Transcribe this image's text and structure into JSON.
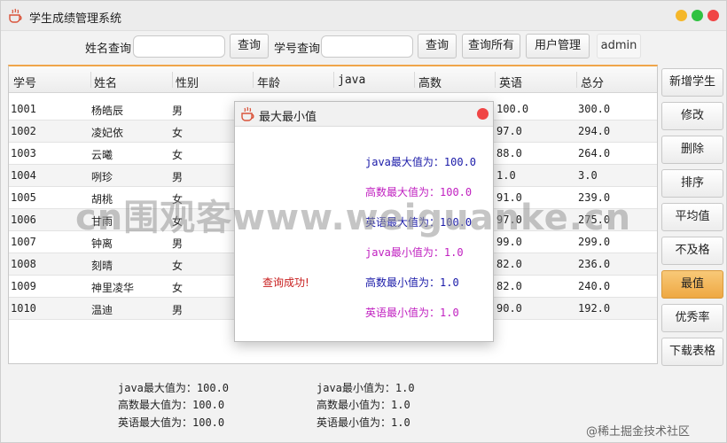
{
  "window": {
    "title": "学生成绩管理系统"
  },
  "toolbar": {
    "name_label": "姓名查询",
    "name_query_value": "",
    "query_btn_1": "查询",
    "id_label": "学号查询",
    "id_query_value": "",
    "query_btn_2": "查询",
    "query_all": "查询所有",
    "user_mgmt": "用户管理",
    "username": "admin"
  },
  "table": {
    "columns": [
      "学号",
      "姓名",
      "性别",
      "年龄",
      "java",
      "高数",
      "英语",
      "总分"
    ],
    "rows": [
      {
        "id": "1001",
        "name": "杨皓辰",
        "gender": "男",
        "english": "100.0",
        "total": "300.0"
      },
      {
        "id": "1002",
        "name": "凌妃依",
        "gender": "女",
        "english": "97.0",
        "total": "294.0"
      },
      {
        "id": "1003",
        "name": "云曦",
        "gender": "女",
        "english": "88.0",
        "total": "264.0"
      },
      {
        "id": "1004",
        "name": "咧珍",
        "gender": "男",
        "english": "1.0",
        "total": "3.0"
      },
      {
        "id": "1005",
        "name": "胡桃",
        "gender": "女",
        "english": "91.0",
        "total": "239.0"
      },
      {
        "id": "1006",
        "name": "甘雨",
        "gender": "女",
        "english": "97.0",
        "total": "275.0"
      },
      {
        "id": "1007",
        "name": "钟离",
        "gender": "男",
        "english": "99.0",
        "total": "299.0"
      },
      {
        "id": "1008",
        "name": "刻晴",
        "gender": "女",
        "english": "82.0",
        "total": "236.0"
      },
      {
        "id": "1009",
        "name": "神里凌华",
        "gender": "女",
        "english": "82.0",
        "total": "240.0"
      },
      {
        "id": "1010",
        "name": "温迪",
        "gender": "男",
        "english": "90.0",
        "total": "192.0"
      }
    ]
  },
  "sidebar": {
    "buttons": [
      "新增学生",
      "修改",
      "删除",
      "排序",
      "平均值",
      "不及格",
      "最值",
      "优秀率",
      "下载表格"
    ],
    "active": "最值"
  },
  "stats": {
    "java_max": "java最大值为：100.0",
    "java_min": "java最小值为：1.0",
    "math_max": "高数最大值为：100.0",
    "math_min": "高数最小值为：1.0",
    "english_max": "英语最大值为：100.0",
    "english_min": "英语最小值为：1.0"
  },
  "dialog": {
    "title": "最大最小值",
    "lines": [
      {
        "text": "java最大值为：100.0",
        "color": "#1a1aa8"
      },
      {
        "text": "高数最大值为：100.0",
        "color": "#c020c0"
      },
      {
        "text": "英语最大值为：100.0",
        "color": "#1a1aa8"
      },
      {
        "text": "java最小值为：1.0",
        "color": "#c020c0"
      },
      {
        "text": "高数最小值为：1.0",
        "color": "#1a1aa8"
      },
      {
        "text": "英语最小值为：1.0",
        "color": "#c020c0"
      }
    ],
    "success": "查询成功!",
    "success_color": "#c81e1e"
  },
  "overlay": {
    "watermark": "cn围观客www.weiguanke.cn",
    "credit": "@稀土掘金技术社区"
  },
  "colors": {
    "accent_orange": "#f0a54a",
    "traffic_yellow": "#f5b72a",
    "traffic_green": "#2fc241",
    "traffic_red": "#f04545"
  }
}
